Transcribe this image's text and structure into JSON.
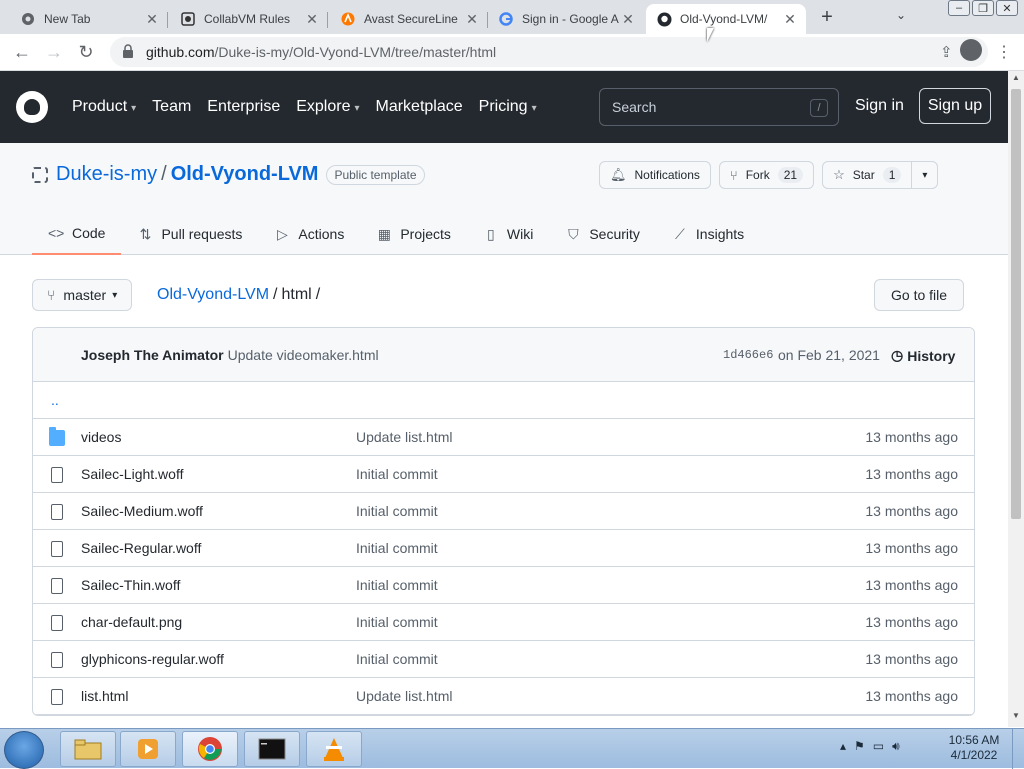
{
  "browser": {
    "tabs": [
      {
        "title": "New Tab",
        "icon": "chrome-newtab-icon"
      },
      {
        "title": "CollabVM Rules",
        "icon": "collabvm-icon"
      },
      {
        "title": "Avast SecureLine",
        "icon": "avast-icon"
      },
      {
        "title": "Sign in - Google A",
        "icon": "google-icon"
      },
      {
        "title": "Old-Vyond-LVM/",
        "icon": "github-icon"
      }
    ],
    "url_host": "github.com",
    "url_path": "/Duke-is-my/Old-Vyond-LVM/tree/master/html"
  },
  "gh_header": {
    "nav": [
      "Product",
      "Team",
      "Enterprise",
      "Explore",
      "Marketplace",
      "Pricing"
    ],
    "search_placeholder": "Search",
    "search_key": "/",
    "signin": "Sign in",
    "signup": "Sign up"
  },
  "repo": {
    "owner": "Duke-is-my",
    "sep": "/",
    "name": "Old-Vyond-LVM",
    "badge": "Public template",
    "notifications": "Notifications",
    "fork_label": "Fork",
    "fork_count": "21",
    "star_label": "Star",
    "star_count": "1",
    "tabs": [
      "Code",
      "Pull requests",
      "Actions",
      "Projects",
      "Wiki",
      "Security",
      "Insights"
    ]
  },
  "filenav": {
    "branch": "master",
    "crumb_repo": "Old-Vyond-LVM",
    "crumb_sep1": "/",
    "crumb_dir": "html",
    "crumb_sep2": "/",
    "goto": "Go to file"
  },
  "commit": {
    "author": "Joseph The Animator",
    "message": "Update videomaker.html",
    "sha": "1d466e6",
    "date": "on Feb 21, 2021",
    "history": "History"
  },
  "updir": "..",
  "files": [
    {
      "name": "videos",
      "type": "dir",
      "msg": "Update list.html",
      "age": "13 months ago"
    },
    {
      "name": "Sailec-Light.woff",
      "type": "file",
      "msg": "Initial commit",
      "age": "13 months ago"
    },
    {
      "name": "Sailec-Medium.woff",
      "type": "file",
      "msg": "Initial commit",
      "age": "13 months ago"
    },
    {
      "name": "Sailec-Regular.woff",
      "type": "file",
      "msg": "Initial commit",
      "age": "13 months ago"
    },
    {
      "name": "Sailec-Thin.woff",
      "type": "file",
      "msg": "Initial commit",
      "age": "13 months ago"
    },
    {
      "name": "char-default.png",
      "type": "file",
      "msg": "Initial commit",
      "age": "13 months ago"
    },
    {
      "name": "glyphicons-regular.woff",
      "type": "file",
      "msg": "Initial commit",
      "age": "13 months ago"
    },
    {
      "name": "list.html",
      "type": "file",
      "msg": "Update list.html",
      "age": "13 months ago"
    }
  ],
  "taskbar": {
    "time": "10:56 AM",
    "date": "4/1/2022"
  }
}
